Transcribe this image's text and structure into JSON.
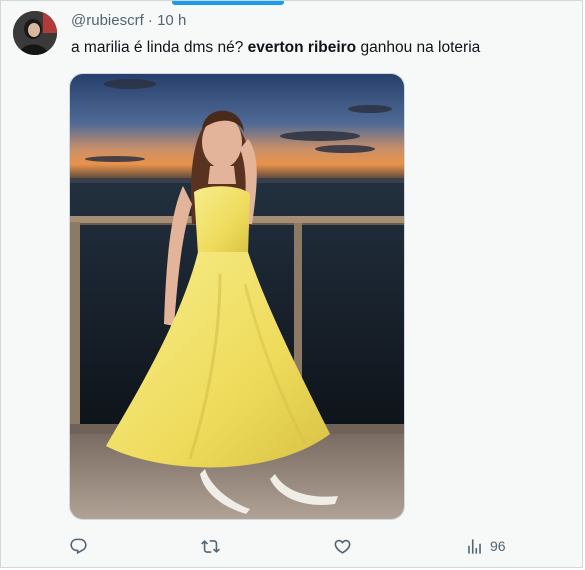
{
  "tweet": {
    "handle": "@rubiescrf",
    "separator": "·",
    "time": "10 h",
    "text_before": "a marilia é linda dms né? ",
    "text_bold": "everton ribeiro",
    "text_after": " ganhou na loteria"
  },
  "actions": {
    "reply_icon": "reply-icon",
    "retweet_icon": "retweet-icon",
    "like_icon": "heart-icon",
    "views_icon": "views-icon",
    "views_count": "96"
  },
  "colors": {
    "accent": "#1d9bf0",
    "text": "#0f1419",
    "muted": "#536471",
    "dress": "#f2e36b"
  }
}
